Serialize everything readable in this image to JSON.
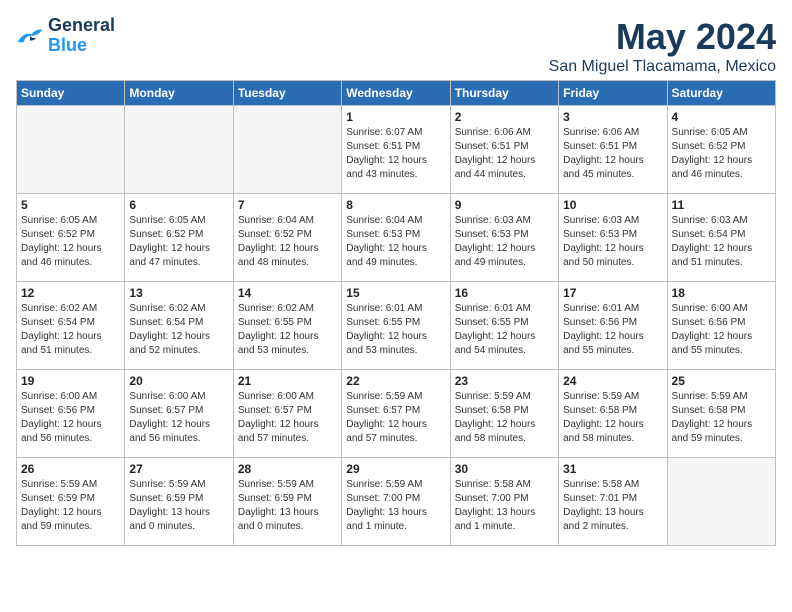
{
  "logo": {
    "line1": "General",
    "line2": "Blue"
  },
  "title": "May 2024",
  "subtitle": "San Miguel Tlacamama, Mexico",
  "days_header": [
    "Sunday",
    "Monday",
    "Tuesday",
    "Wednesday",
    "Thursday",
    "Friday",
    "Saturday"
  ],
  "weeks": [
    [
      {
        "num": "",
        "info": ""
      },
      {
        "num": "",
        "info": ""
      },
      {
        "num": "",
        "info": ""
      },
      {
        "num": "1",
        "info": "Sunrise: 6:07 AM\nSunset: 6:51 PM\nDaylight: 12 hours\nand 43 minutes."
      },
      {
        "num": "2",
        "info": "Sunrise: 6:06 AM\nSunset: 6:51 PM\nDaylight: 12 hours\nand 44 minutes."
      },
      {
        "num": "3",
        "info": "Sunrise: 6:06 AM\nSunset: 6:51 PM\nDaylight: 12 hours\nand 45 minutes."
      },
      {
        "num": "4",
        "info": "Sunrise: 6:05 AM\nSunset: 6:52 PM\nDaylight: 12 hours\nand 46 minutes."
      }
    ],
    [
      {
        "num": "5",
        "info": "Sunrise: 6:05 AM\nSunset: 6:52 PM\nDaylight: 12 hours\nand 46 minutes."
      },
      {
        "num": "6",
        "info": "Sunrise: 6:05 AM\nSunset: 6:52 PM\nDaylight: 12 hours\nand 47 minutes."
      },
      {
        "num": "7",
        "info": "Sunrise: 6:04 AM\nSunset: 6:52 PM\nDaylight: 12 hours\nand 48 minutes."
      },
      {
        "num": "8",
        "info": "Sunrise: 6:04 AM\nSunset: 6:53 PM\nDaylight: 12 hours\nand 49 minutes."
      },
      {
        "num": "9",
        "info": "Sunrise: 6:03 AM\nSunset: 6:53 PM\nDaylight: 12 hours\nand 49 minutes."
      },
      {
        "num": "10",
        "info": "Sunrise: 6:03 AM\nSunset: 6:53 PM\nDaylight: 12 hours\nand 50 minutes."
      },
      {
        "num": "11",
        "info": "Sunrise: 6:03 AM\nSunset: 6:54 PM\nDaylight: 12 hours\nand 51 minutes."
      }
    ],
    [
      {
        "num": "12",
        "info": "Sunrise: 6:02 AM\nSunset: 6:54 PM\nDaylight: 12 hours\nand 51 minutes."
      },
      {
        "num": "13",
        "info": "Sunrise: 6:02 AM\nSunset: 6:54 PM\nDaylight: 12 hours\nand 52 minutes."
      },
      {
        "num": "14",
        "info": "Sunrise: 6:02 AM\nSunset: 6:55 PM\nDaylight: 12 hours\nand 53 minutes."
      },
      {
        "num": "15",
        "info": "Sunrise: 6:01 AM\nSunset: 6:55 PM\nDaylight: 12 hours\nand 53 minutes."
      },
      {
        "num": "16",
        "info": "Sunrise: 6:01 AM\nSunset: 6:55 PM\nDaylight: 12 hours\nand 54 minutes."
      },
      {
        "num": "17",
        "info": "Sunrise: 6:01 AM\nSunset: 6:56 PM\nDaylight: 12 hours\nand 55 minutes."
      },
      {
        "num": "18",
        "info": "Sunrise: 6:00 AM\nSunset: 6:56 PM\nDaylight: 12 hours\nand 55 minutes."
      }
    ],
    [
      {
        "num": "19",
        "info": "Sunrise: 6:00 AM\nSunset: 6:56 PM\nDaylight: 12 hours\nand 56 minutes."
      },
      {
        "num": "20",
        "info": "Sunrise: 6:00 AM\nSunset: 6:57 PM\nDaylight: 12 hours\nand 56 minutes."
      },
      {
        "num": "21",
        "info": "Sunrise: 6:00 AM\nSunset: 6:57 PM\nDaylight: 12 hours\nand 57 minutes."
      },
      {
        "num": "22",
        "info": "Sunrise: 5:59 AM\nSunset: 6:57 PM\nDaylight: 12 hours\nand 57 minutes."
      },
      {
        "num": "23",
        "info": "Sunrise: 5:59 AM\nSunset: 6:58 PM\nDaylight: 12 hours\nand 58 minutes."
      },
      {
        "num": "24",
        "info": "Sunrise: 5:59 AM\nSunset: 6:58 PM\nDaylight: 12 hours\nand 58 minutes."
      },
      {
        "num": "25",
        "info": "Sunrise: 5:59 AM\nSunset: 6:58 PM\nDaylight: 12 hours\nand 59 minutes."
      }
    ],
    [
      {
        "num": "26",
        "info": "Sunrise: 5:59 AM\nSunset: 6:59 PM\nDaylight: 12 hours\nand 59 minutes."
      },
      {
        "num": "27",
        "info": "Sunrise: 5:59 AM\nSunset: 6:59 PM\nDaylight: 13 hours\nand 0 minutes."
      },
      {
        "num": "28",
        "info": "Sunrise: 5:59 AM\nSunset: 6:59 PM\nDaylight: 13 hours\nand 0 minutes."
      },
      {
        "num": "29",
        "info": "Sunrise: 5:59 AM\nSunset: 7:00 PM\nDaylight: 13 hours\nand 1 minute."
      },
      {
        "num": "30",
        "info": "Sunrise: 5:58 AM\nSunset: 7:00 PM\nDaylight: 13 hours\nand 1 minute."
      },
      {
        "num": "31",
        "info": "Sunrise: 5:58 AM\nSunset: 7:01 PM\nDaylight: 13 hours\nand 2 minutes."
      },
      {
        "num": "",
        "info": ""
      }
    ]
  ]
}
